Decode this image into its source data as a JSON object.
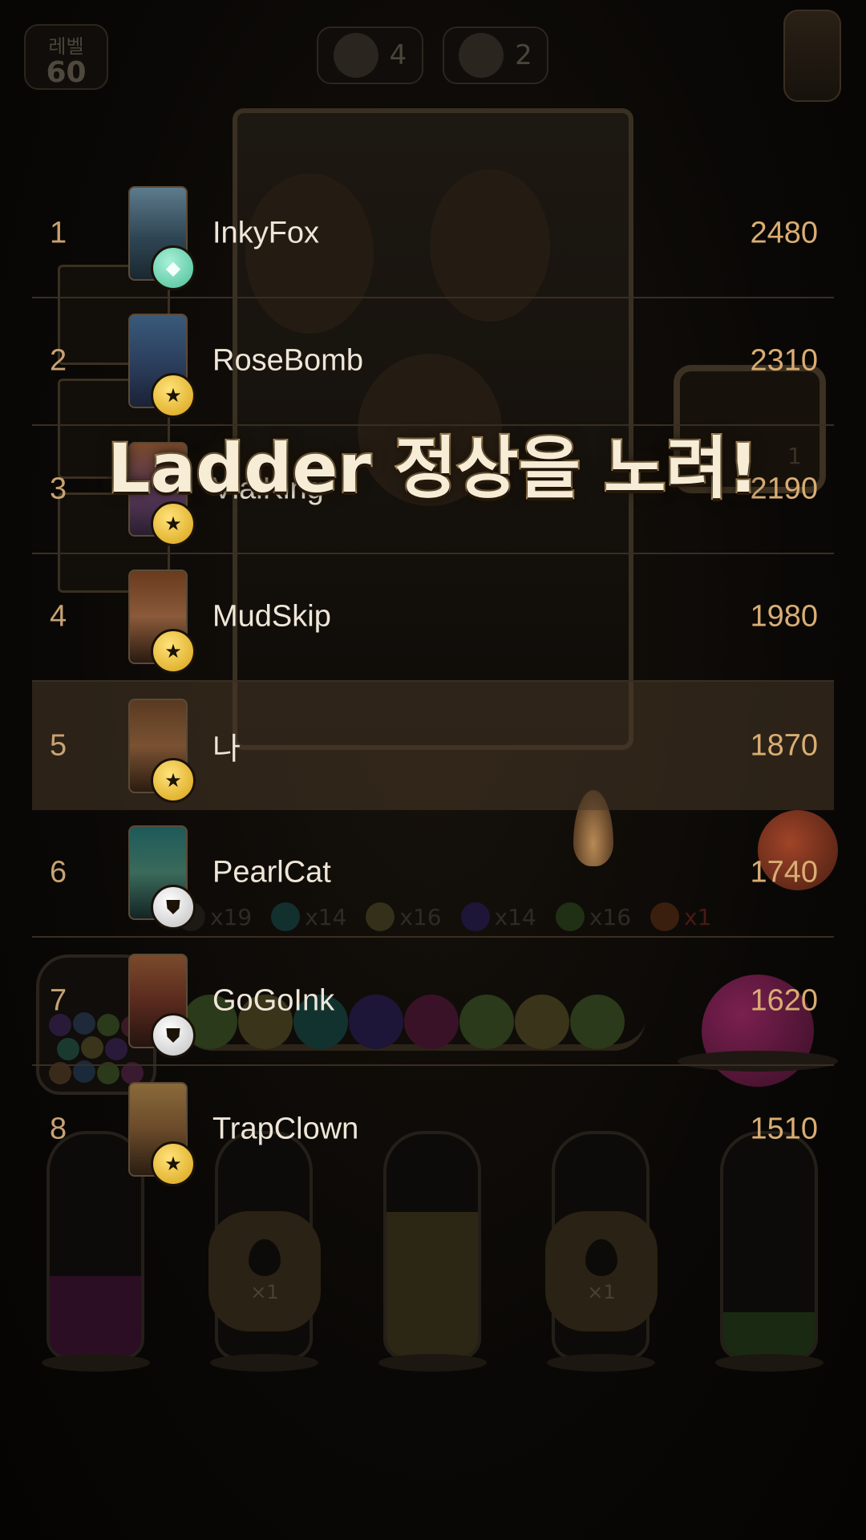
{
  "hud": {
    "level_label": "레벨",
    "level_value": "60",
    "counter_1": {
      "icon": "octopus-icon",
      "value": "4"
    },
    "counter_2": {
      "icon": "robot-icon",
      "value": "2"
    }
  },
  "headline": "Ladder 정상을 노려!",
  "ladder": [
    {
      "rank": "1",
      "name": "InkyFox",
      "score": "2480",
      "badge": "gem-icon"
    },
    {
      "rank": "2",
      "name": "RoseBomb",
      "score": "2310",
      "badge": "star-icon"
    },
    {
      "rank": "3",
      "name": "VialKing",
      "score": "2190",
      "badge": "star-icon"
    },
    {
      "rank": "4",
      "name": "MudSkip",
      "score": "1980",
      "badge": "star-icon"
    },
    {
      "rank": "5",
      "name": "나",
      "score": "1870",
      "badge": "star-icon",
      "is_me": true
    },
    {
      "rank": "6",
      "name": "PearlCat",
      "score": "1740",
      "badge": "shield-icon"
    },
    {
      "rank": "7",
      "name": "GoGoInk",
      "score": "1620",
      "badge": "shield-icon"
    },
    {
      "rank": "8",
      "name": "TrapClown",
      "score": "1510",
      "badge": "star-icon"
    }
  ],
  "ball_counts": [
    "x19",
    "x14",
    "x16",
    "x14",
    "x16",
    "x1"
  ],
  "booster_count": "1",
  "drop_boosters": [
    "×1",
    "×1"
  ],
  "colors": {
    "gold_text": "#d9ad73",
    "rank_text": "#c8a273",
    "name_text": "#efe6d8",
    "highlight_row": "#483826",
    "headline_fill": "#f7ecd6",
    "headline_outline": "#d7b370"
  }
}
